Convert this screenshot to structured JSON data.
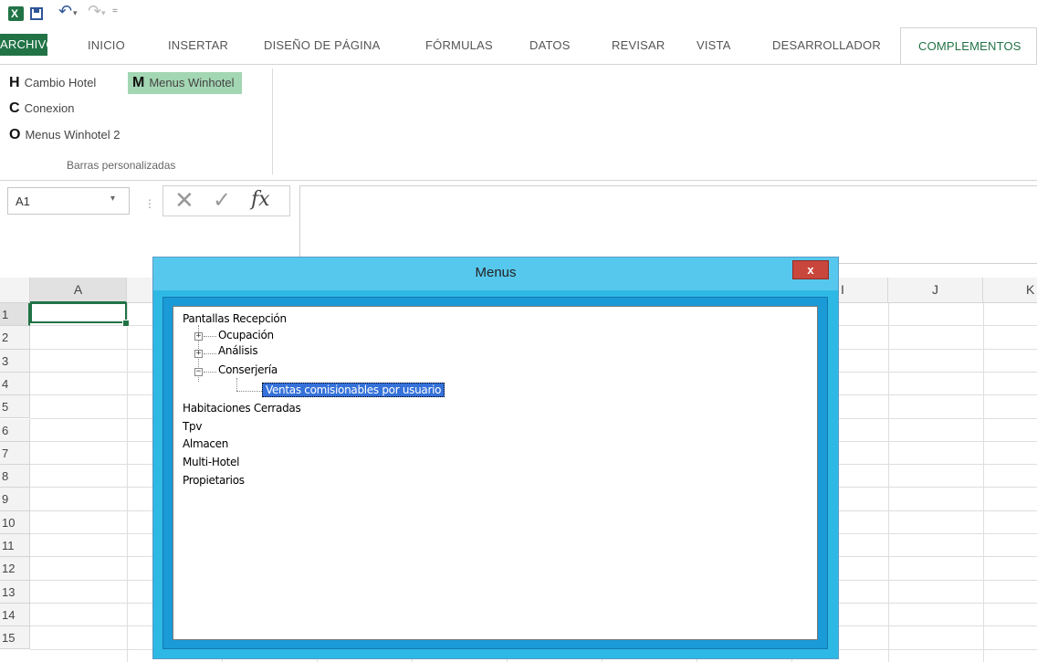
{
  "qat": {
    "app_icon_letter": "X",
    "undo_glyph": "↶",
    "redo_glyph": "↷",
    "dd": "▾",
    "more": "="
  },
  "tabs": {
    "archivo": "ARCHIVO",
    "inicio": "INICIO",
    "insertar": "INSERTAR",
    "diseno": "DISEÑO DE PÁGINA",
    "formulas": "FÓRMULAS",
    "datos": "DATOS",
    "revisar": "REVISAR",
    "vista": "VISTA",
    "desarrollador": "DESARROLLADOR",
    "complementos": "COMPLEMENTOS"
  },
  "ribbon": {
    "items": [
      {
        "key": "H",
        "label": "Cambio Hotel"
      },
      {
        "key": "M",
        "label": "Menus Winhotel"
      },
      {
        "key": "C",
        "label": "Conexion"
      },
      {
        "key": "O",
        "label": "Menus Winhotel 2"
      }
    ],
    "group_label": "Barras personalizadas"
  },
  "formula_bar": {
    "name_box": "A1",
    "dd": "▾",
    "dots": "⋮",
    "cancel": "✕",
    "enter": "✓",
    "fx": "fx"
  },
  "grid": {
    "columns": [
      "A",
      "",
      "",
      "",
      "",
      "",
      "",
      "",
      "J",
      "K"
    ],
    "rows": [
      "1",
      "2",
      "3",
      "4",
      "5",
      "6",
      "7",
      "8",
      "9",
      "10",
      "11",
      "12",
      "13",
      "14",
      "15"
    ],
    "partial_col_label": "I"
  },
  "dialog": {
    "title": "Menus",
    "close": "x",
    "tree": {
      "root1": "Pantallas Recepción",
      "ocupacion": "Ocupación",
      "analisis": "Análisis",
      "conserjeria": "Conserjería",
      "ventas": "Ventas comisionables por usuario",
      "habitaciones": "Habitaciones Cerradas",
      "tpv": "Tpv",
      "almacen": "Almacen",
      "multihotel": "Multi-Hotel",
      "propietarios": "Propietarios",
      "plus": "+",
      "minus": "−"
    }
  },
  "colors": {
    "excel_green": "#217346",
    "dialog_blue": "#2eb9e4",
    "selection": "#3571d9"
  }
}
